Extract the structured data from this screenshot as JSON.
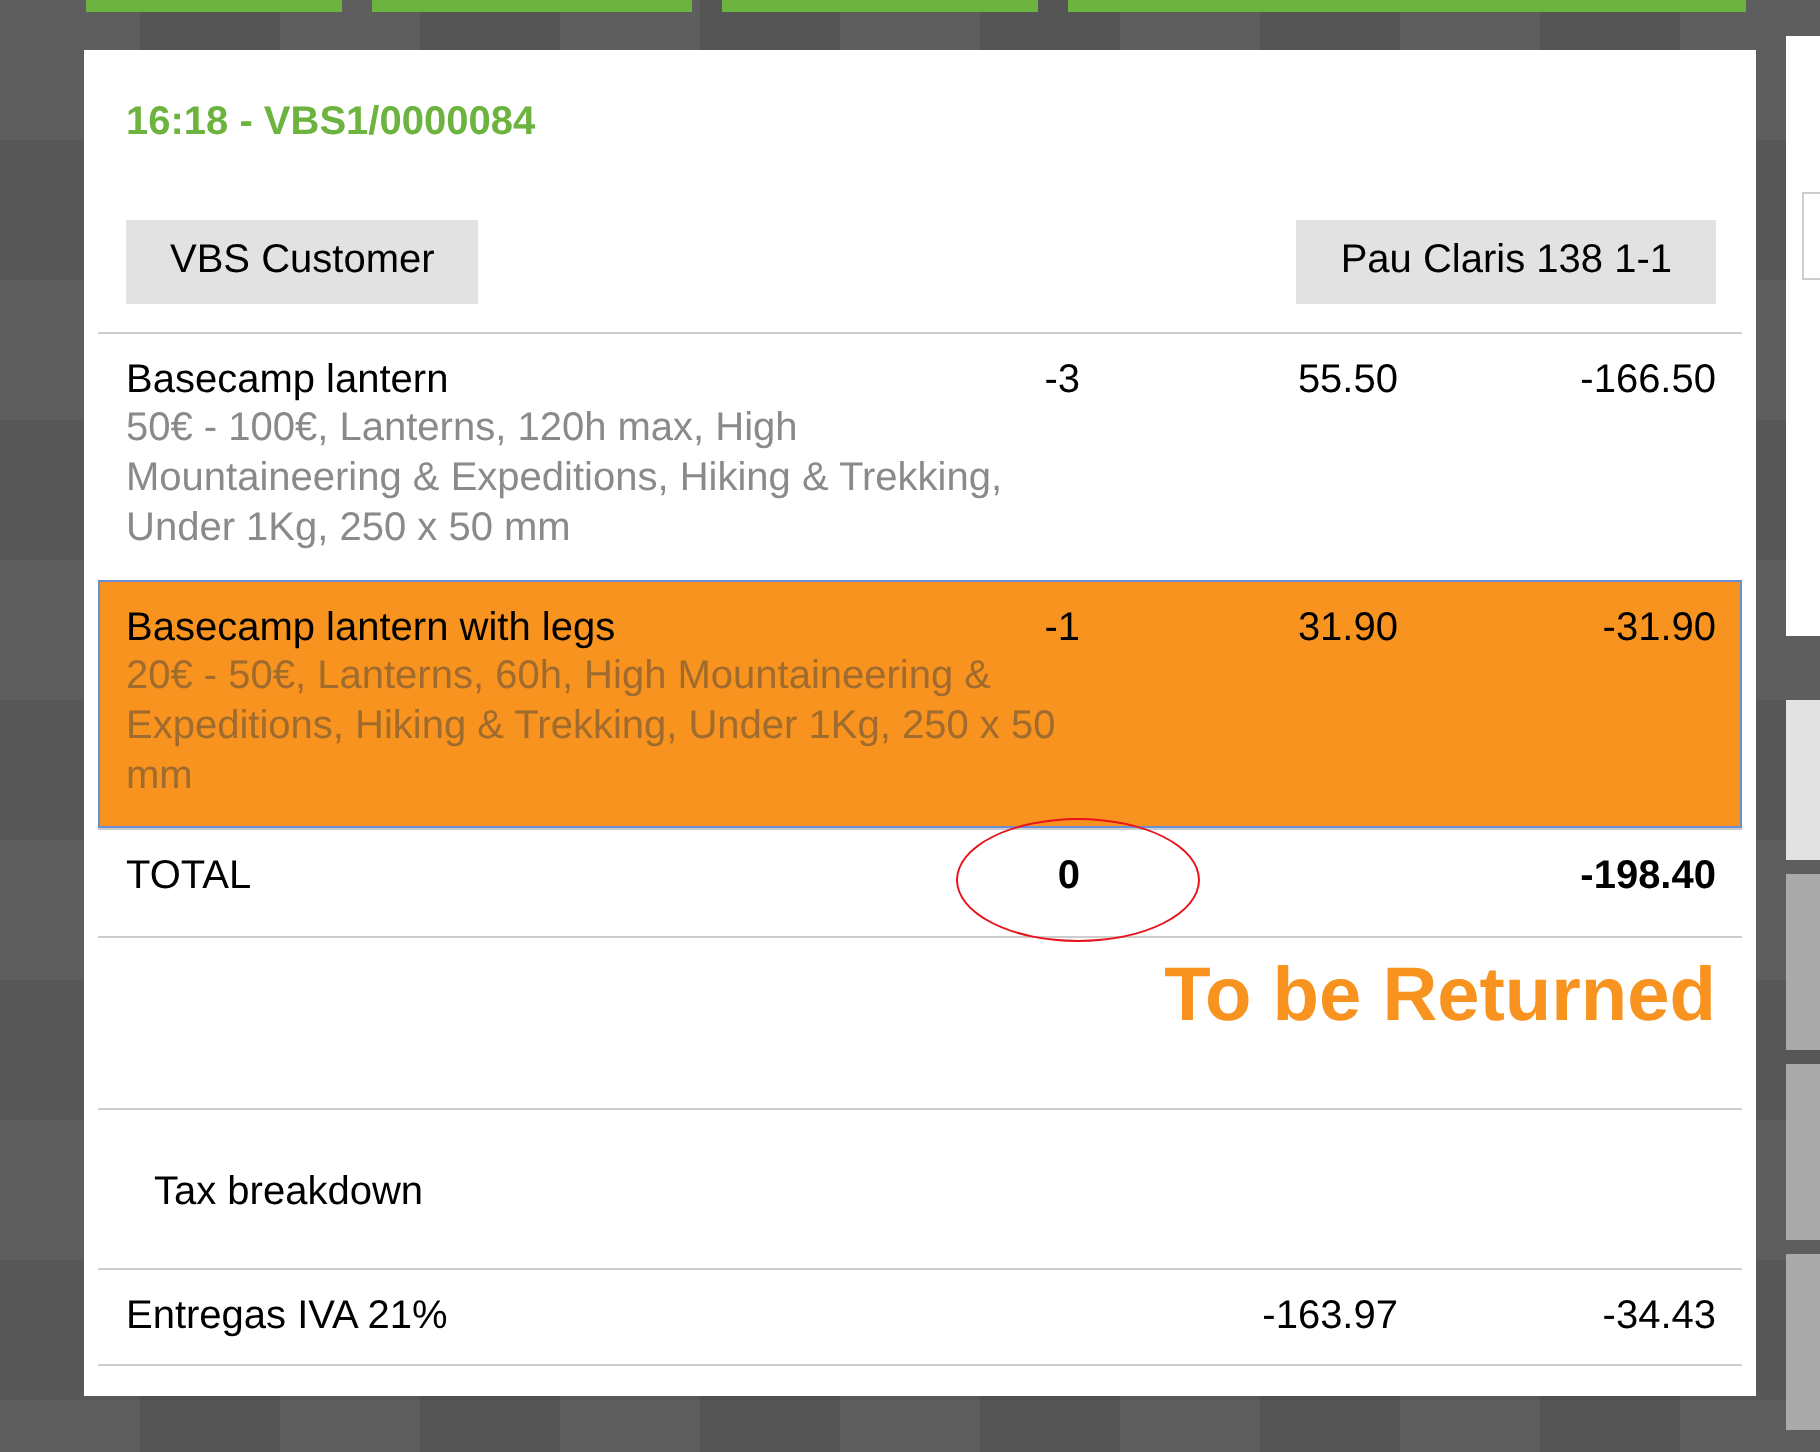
{
  "receipt": {
    "title": "16:18 - VBS1/0000084",
    "customer": "VBS Customer",
    "location": "Pau Claris 138 1-1",
    "lines": [
      {
        "product": "Basecamp lantern",
        "attributes": "50€ - 100€, Lanterns, 120h max, High Mountaineering & Expeditions, Hiking & Trekking, Under 1Kg, 250 x 50 mm",
        "quantity": "-3",
        "price": "55.50",
        "total": "-166.50",
        "selected": false
      },
      {
        "product": "Basecamp lantern with legs",
        "attributes": "20€ - 50€, Lanterns, 60h, High Mountaineering & Expeditions, Hiking & Trekking, Under 1Kg, 250 x 50 mm",
        "quantity": "-1",
        "price": "31.90",
        "total": "-31.90",
        "selected": true
      }
    ],
    "total": {
      "label": "TOTAL",
      "quantity": "0",
      "amount": "-198.40",
      "circled": true
    },
    "status": "To be Returned",
    "tax_breakdown": {
      "title": "Tax breakdown",
      "rows": [
        {
          "name": "Entregas IVA 21%",
          "base": "-163.97",
          "amount": "-34.43"
        }
      ]
    }
  }
}
